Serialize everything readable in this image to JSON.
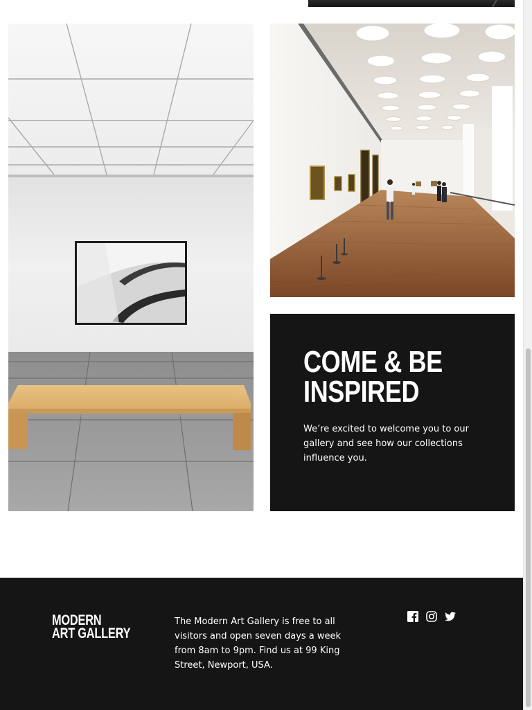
{
  "callout": {
    "title_line1": "COME & BE",
    "title_line2": "INSPIRED",
    "body": "We’re excited to welcome you to our gallery and see how our collections influence you."
  },
  "images": {
    "left_icon": "gallery-bench-photo",
    "right_icon": "gallery-hall-photo"
  },
  "footer": {
    "logo_line1": "MODERN",
    "logo_line2": "ART GALLERY",
    "info": "The Modern Art Gallery is free to all visitors and open seven days a week from 8am to 9pm. Find us at 99 King Street, Newport, USA.",
    "social": [
      {
        "icon": "facebook-icon"
      },
      {
        "icon": "instagram-icon"
      },
      {
        "icon": "twitter-icon"
      }
    ]
  },
  "colors": {
    "dark": "#151515",
    "text_light": "#ffffff",
    "background": "#ffffff"
  }
}
